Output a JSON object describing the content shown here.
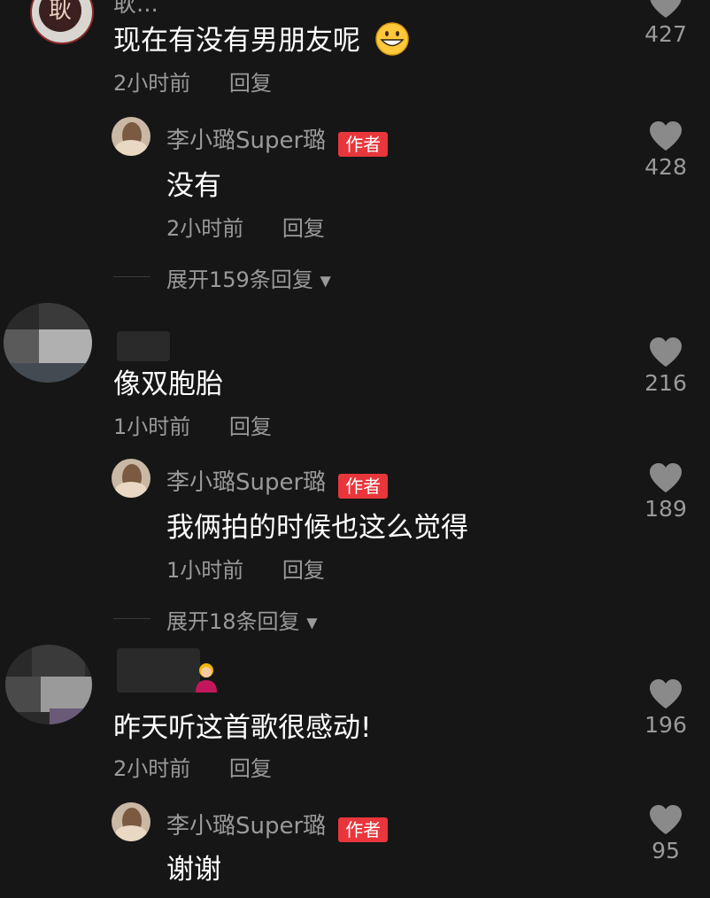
{
  "comments": [
    {
      "username": "耿...",
      "avatar_text": "耿",
      "text": "现在有没有男朋友呢",
      "emoji": "grinning-face",
      "time": "2小时前",
      "reply_label": "回复",
      "likes": "427"
    },
    {
      "username": "李小璐Super璐",
      "badge": "作者",
      "text": "没有",
      "time": "2小时前",
      "reply_label": "回复",
      "likes": "428",
      "expand": "展开159条回复"
    },
    {
      "text": "像双胞胎",
      "time": "1小时前",
      "reply_label": "回复",
      "likes": "216"
    },
    {
      "username": "李小璐Super璐",
      "badge": "作者",
      "text": "我俩拍的时候也这么觉得",
      "time": "1小时前",
      "reply_label": "回复",
      "likes": "189",
      "expand": "展开18条回复"
    },
    {
      "text": "昨天听这首歌很感动!",
      "time": "2小时前",
      "reply_label": "回复",
      "likes": "196"
    },
    {
      "username": "李小璐Super璐",
      "badge": "作者",
      "text": "谢谢",
      "likes": "95"
    }
  ],
  "colors": {
    "background": "#161616",
    "secondary_text": "#9a9a9a",
    "badge": "#e8363c",
    "heart": "#8a8a8a"
  }
}
